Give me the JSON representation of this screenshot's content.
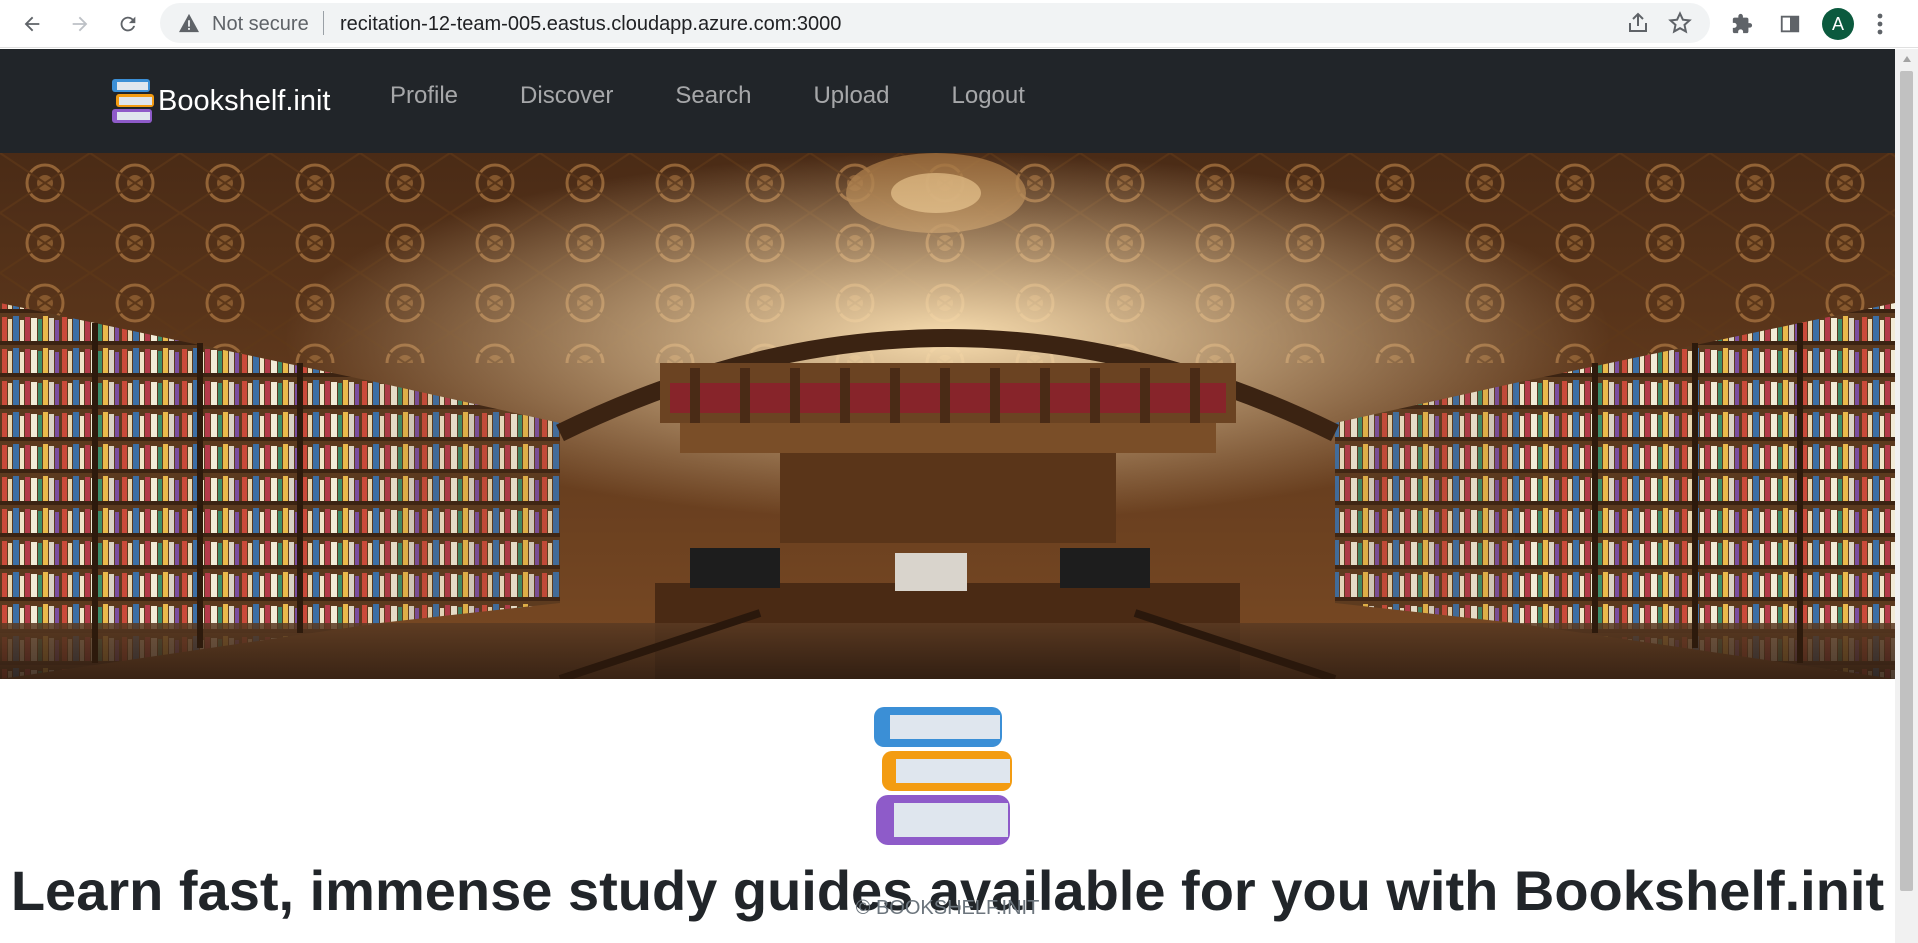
{
  "browser": {
    "security_label": "Not secure",
    "url": "recitation-12-team-005.eastus.cloudapp.azure.com:3000",
    "profile_initial": "A",
    "icons": [
      "back-icon",
      "forward-icon",
      "reload-icon",
      "warning-icon",
      "share-icon",
      "star-icon",
      "extensions-icon",
      "sidepanel-icon",
      "menu-icon"
    ]
  },
  "navbar": {
    "brand": "Bookshelf.init",
    "links": [
      "Profile",
      "Discover",
      "Search",
      "Upload",
      "Logout"
    ]
  },
  "main": {
    "headline": "Learn fast, immense study guides available for you with Bookshelf.init"
  },
  "footer": {
    "text": "© BOOKSHELF.INIT"
  },
  "colors": {
    "navbar_bg": "#212529",
    "book_blue": "#3b8fd6",
    "book_orange": "#f39c12",
    "book_purple": "#8e5bc9"
  }
}
